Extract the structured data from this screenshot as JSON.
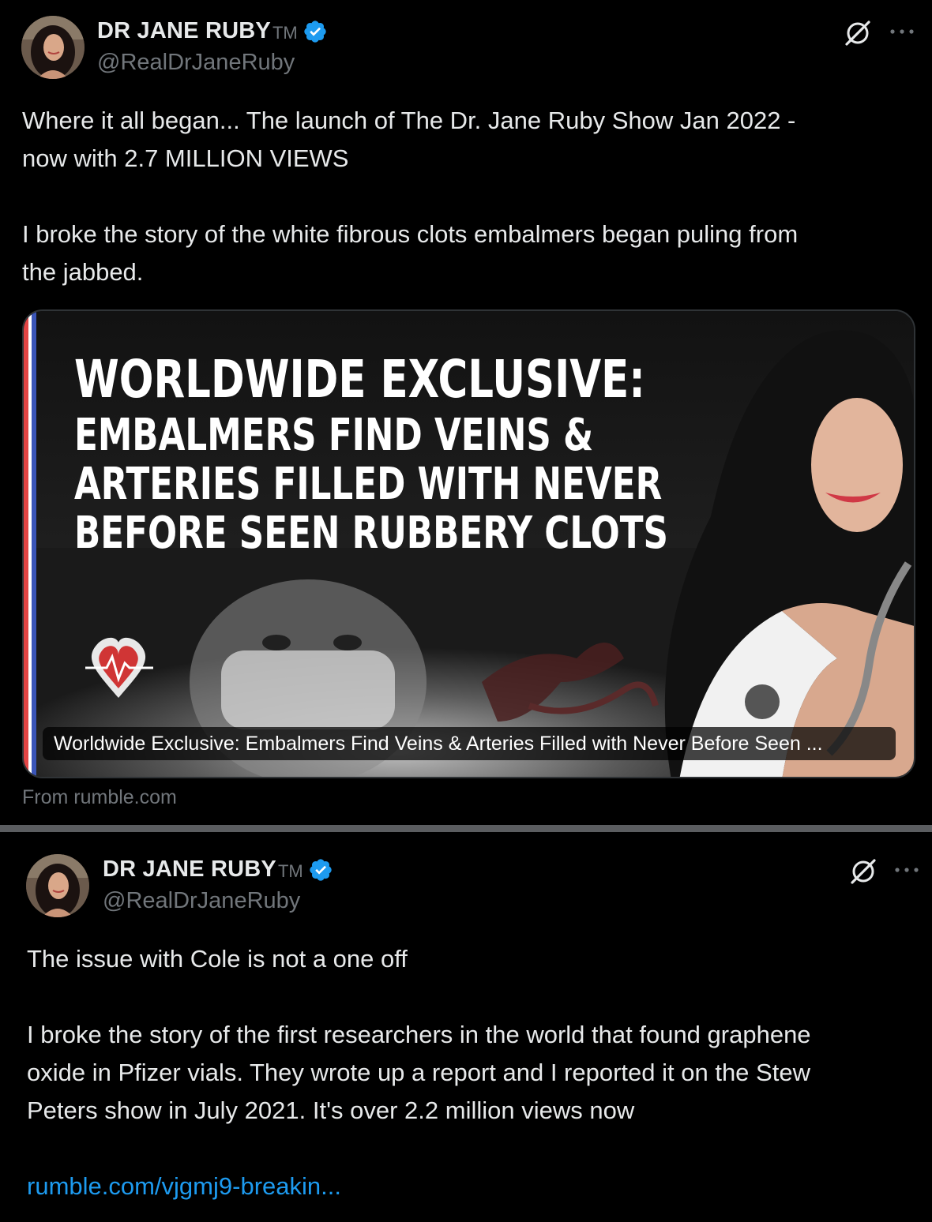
{
  "tweets": [
    {
      "author_name": "DR JANE RUBY",
      "tm": "TM",
      "handle": "@RealDrJaneRuby",
      "text_lines": [
        "Where it all began... The launch of The Dr. Jane Ruby Show Jan 2022 -",
        "now with 2.7 MILLION VIEWS",
        "",
        "I broke the story of the white fibrous clots embalmers began puling from",
        "the jabbed."
      ],
      "card": {
        "headline_line1": "WORLDWIDE EXCLUSIVE:",
        "headline_line2": "EMBALMERS FIND VEINS &",
        "headline_line3": "ARTERIES FILLED WITH NEVER",
        "headline_line4": "BEFORE SEEN RUBBERY CLOTS",
        "title": "Worldwide Exclusive: Embalmers Find Veins & Arteries Filled with Never Before Seen ...",
        "source": "From rumble.com"
      }
    },
    {
      "author_name": "DR JANE RUBY",
      "tm": "TM",
      "handle": "@RealDrJaneRuby",
      "text_lines": [
        "The issue with Cole is not a one off",
        "",
        "I broke the story of the first researchers in the world that found graphene",
        "oxide in Pfizer vials. They wrote up a report and I reported it on the Stew",
        "Peters show in July 2021. It's over 2.2 million views now",
        ""
      ],
      "link": "rumble.com/vjgmj9-breakin..."
    }
  ],
  "icons": {
    "verified": "verified-badge-icon",
    "grok": "grok-icon",
    "more": "more-options-icon"
  },
  "colors": {
    "background": "#000000",
    "text": "#e7e9ea",
    "secondary": "#71767b",
    "link": "#1d9bf0",
    "verified": "#1d9bf0",
    "divider": "#5b5d60"
  }
}
